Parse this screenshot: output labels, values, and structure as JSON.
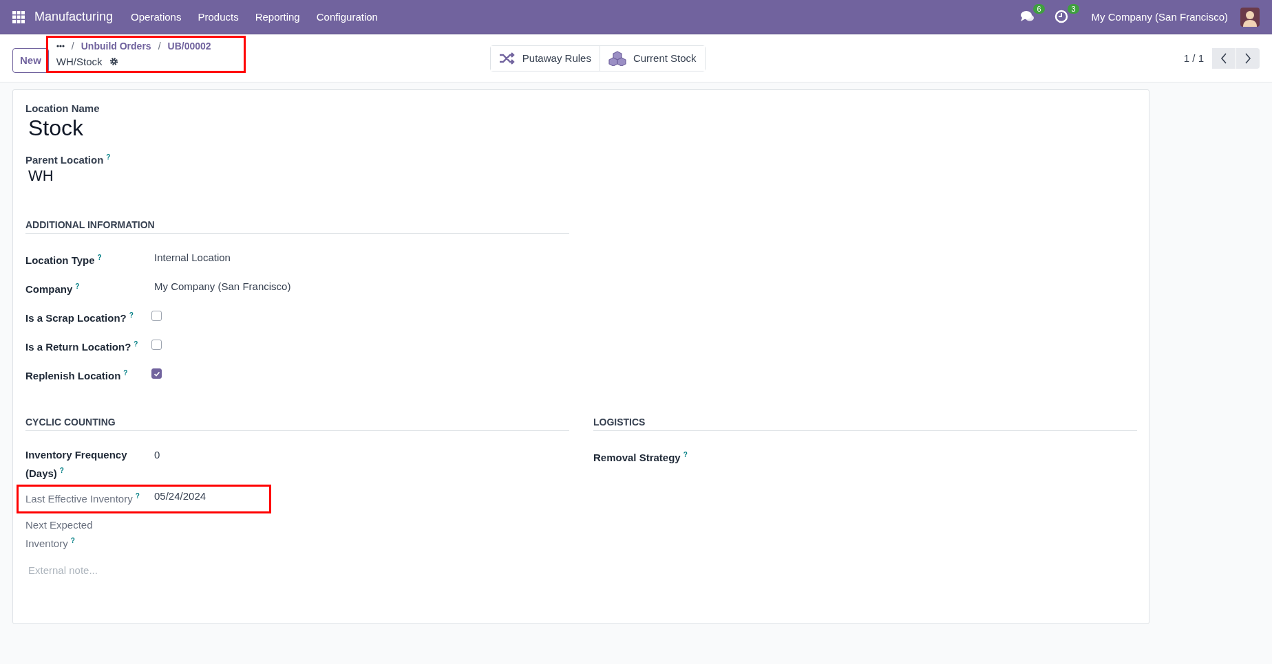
{
  "navbar": {
    "app": "Manufacturing",
    "menu": [
      "Operations",
      "Products",
      "Reporting",
      "Configuration"
    ],
    "messages_count": "6",
    "activities_count": "3",
    "company": "My Company (San Francisco)"
  },
  "control_panel": {
    "new_button": "New",
    "breadcrumbs": [
      "Unbuild Orders",
      "UB/00002"
    ],
    "separator": "/",
    "record": "WH/Stock",
    "highlighted": true,
    "smart_buttons": [
      {
        "label": "Putaway Rules",
        "kind": "shuffle"
      },
      {
        "label": "Current Stock",
        "kind": "cubes"
      }
    ],
    "pager": "1 / 1"
  },
  "form": {
    "name_label": "Location Name",
    "name": "Stock",
    "parent_label": "Parent Location",
    "parent_help": "?",
    "parent": "WH",
    "additional": {
      "title": "ADDITIONAL INFORMATION",
      "fields": [
        {
          "kind": "text",
          "label": "Location Type",
          "help": "?",
          "value": "Internal Location"
        },
        {
          "kind": "text",
          "label": "Company",
          "help": "?",
          "value": "My Company (San Francisco)"
        },
        {
          "kind": "checkbox",
          "label": "Is a Scrap Location?",
          "help": "?",
          "checked": false
        },
        {
          "kind": "checkbox",
          "label": "Is a Return Location?",
          "help": "?",
          "checked": false
        },
        {
          "kind": "checkbox",
          "label": "Replenish Location",
          "help": "?",
          "checked": true
        }
      ]
    },
    "cyclic": {
      "title": "CYCLIC COUNTING",
      "fields": [
        {
          "kind": "text",
          "label": "Inventory Frequency (Days)",
          "help": "?",
          "value": "0",
          "readonly": false,
          "highlighted": false
        },
        {
          "kind": "text",
          "label": "Last Effective Inventory",
          "help": "?",
          "value": "05/24/2024",
          "readonly": true,
          "highlighted": true
        },
        {
          "kind": "text",
          "label": "Next Expected Inventory",
          "help": "?",
          "readonly": true,
          "highlighted": false
        }
      ]
    },
    "logistics": {
      "title": "LOGISTICS",
      "fields": [
        {
          "kind": "text",
          "label": "Removal Strategy",
          "help": "?"
        }
      ]
    },
    "note_placeholder": "External note..."
  }
}
